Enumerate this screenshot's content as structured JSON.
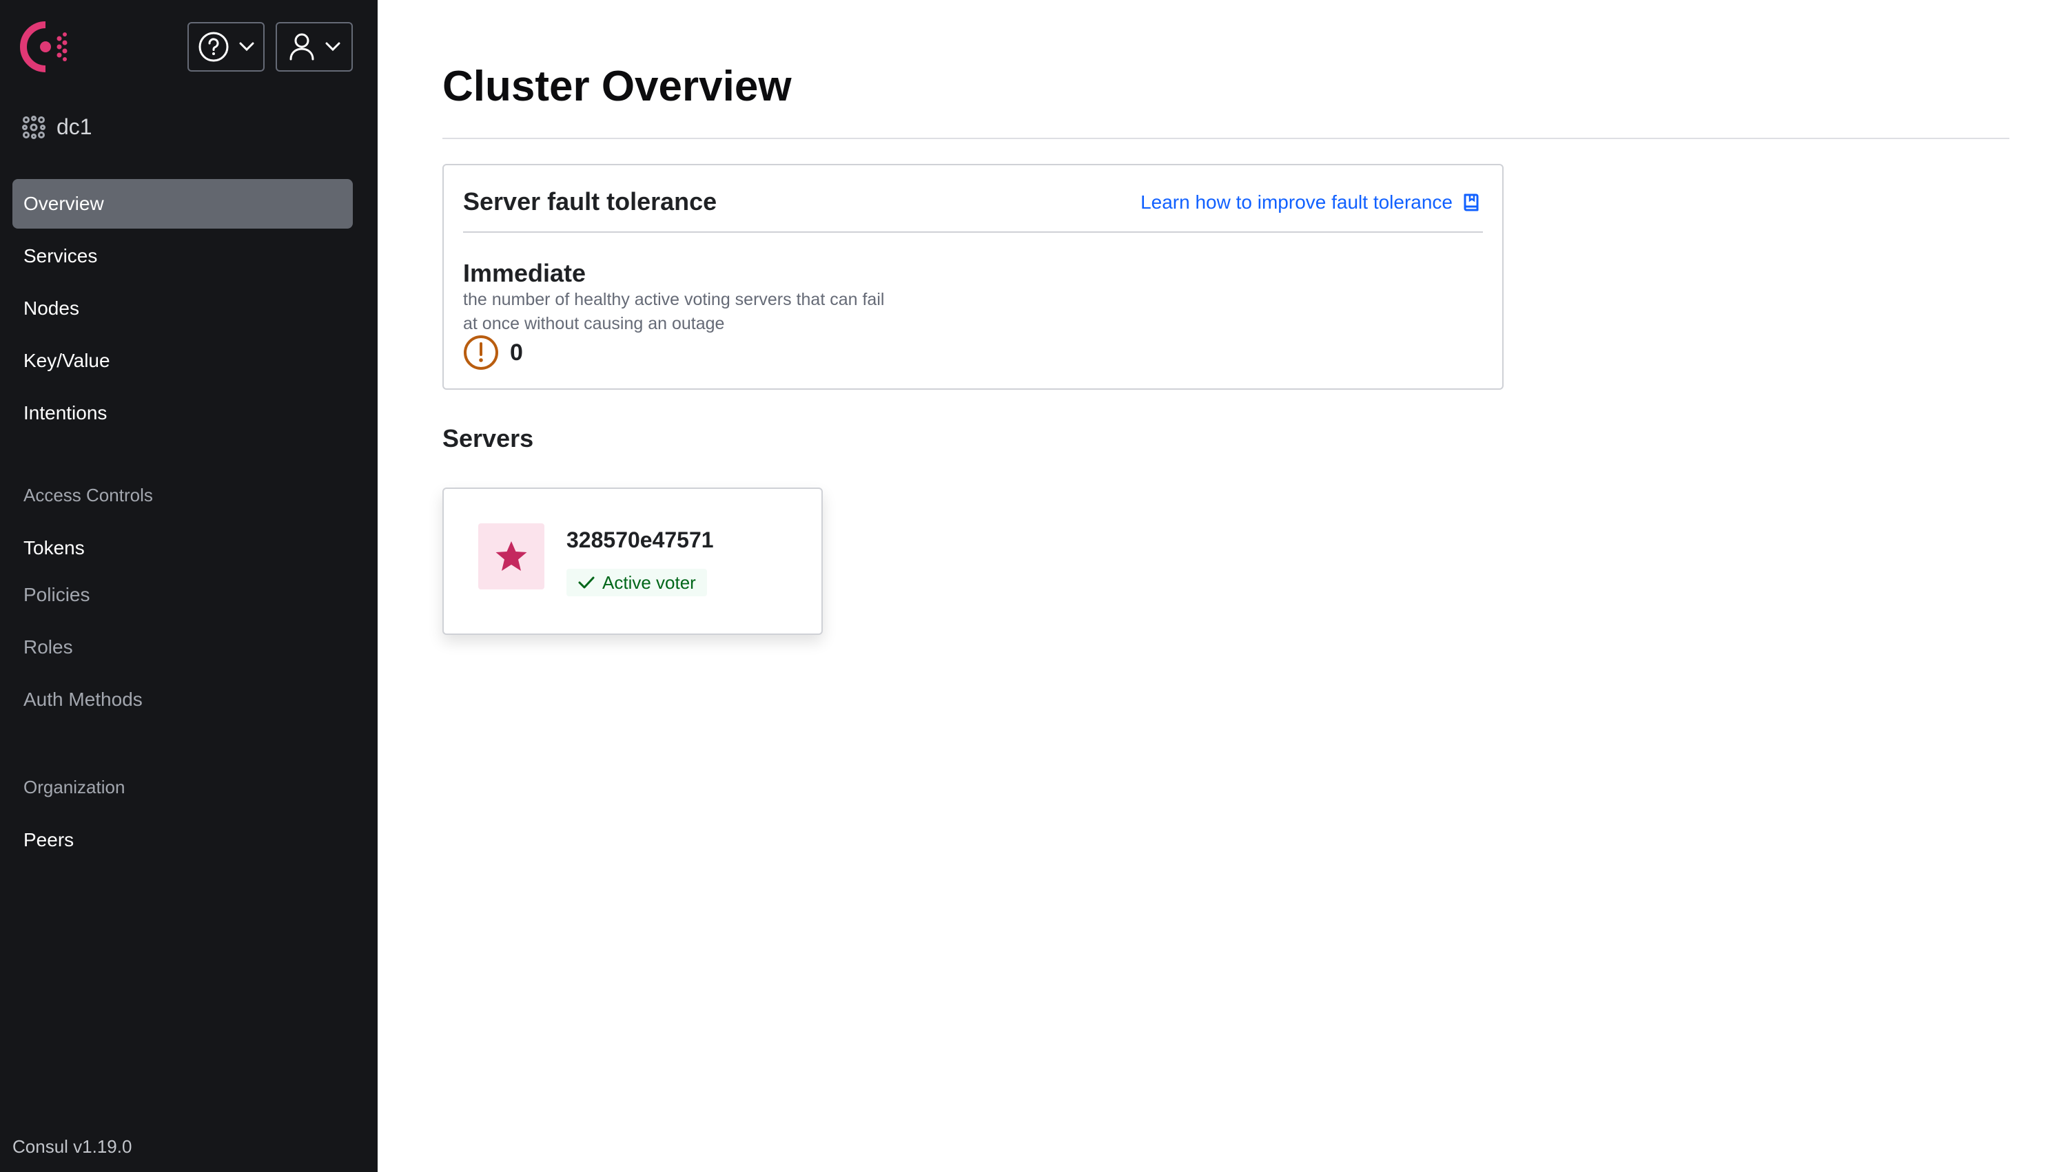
{
  "app": {
    "version": "Consul v1.19.0",
    "brand_color": "#e03875"
  },
  "sidebar": {
    "datacenter": "dc1",
    "help_icon": "help-circle-icon",
    "user_icon": "user-icon",
    "nav": [
      {
        "label": "Overview",
        "active": true
      },
      {
        "label": "Services"
      },
      {
        "label": "Nodes"
      },
      {
        "label": "Key/Value"
      },
      {
        "label": "Intentions"
      }
    ],
    "access_controls": {
      "heading": "Access Controls",
      "items": [
        "Tokens",
        "Policies",
        "Roles",
        "Auth Methods"
      ]
    },
    "organization": {
      "heading": "Organization",
      "items": [
        "Peers"
      ]
    }
  },
  "main": {
    "title": "Cluster Overview",
    "fault_tolerance": {
      "heading": "Server fault tolerance",
      "link": "Learn how to improve fault tolerance",
      "level": "Immediate",
      "description_line1": "the number of healthy active voting servers that can fail",
      "description_line2": "at once without causing an outage",
      "value": "0",
      "warning_color": "#b95d0f"
    },
    "servers": {
      "heading": "Servers",
      "items": [
        {
          "name": "328570e47571",
          "status": "Active voter",
          "icon": "star-icon"
        }
      ]
    }
  }
}
